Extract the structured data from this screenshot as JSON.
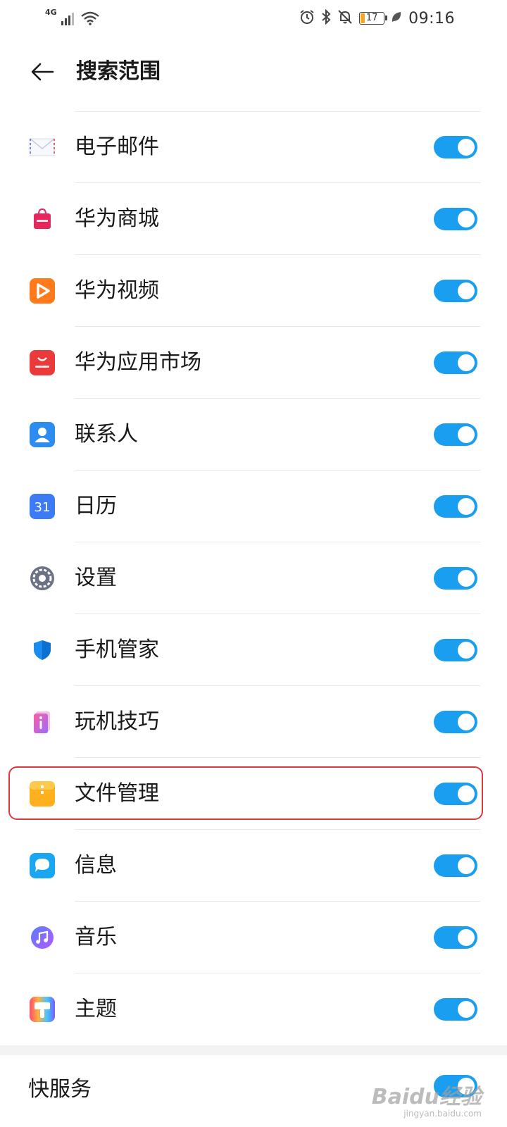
{
  "status_bar": {
    "network": "4G",
    "time": "09:16",
    "battery": "17",
    "battery_level_percent": 17,
    "icons": [
      "signal-icon",
      "wifi-icon",
      "alarm-icon",
      "bluetooth-icon",
      "mute-icon",
      "battery-icon",
      "leaf-icon"
    ]
  },
  "header": {
    "title": "搜索范围",
    "back_icon": "back-arrow-icon"
  },
  "items": [
    {
      "label": "电子邮件",
      "icon": "email-icon",
      "enabled": true
    },
    {
      "label": "华为商城",
      "icon": "vmall-icon",
      "enabled": true
    },
    {
      "label": "华为视频",
      "icon": "video-icon",
      "enabled": true
    },
    {
      "label": "华为应用市场",
      "icon": "appgallery-icon",
      "enabled": true
    },
    {
      "label": "联系人",
      "icon": "contacts-icon",
      "enabled": true
    },
    {
      "label": "日历",
      "icon": "calendar-icon",
      "enabled": true,
      "icon_text": "31"
    },
    {
      "label": "设置",
      "icon": "settings-icon",
      "enabled": true
    },
    {
      "label": "手机管家",
      "icon": "phone-manager-icon",
      "enabled": true
    },
    {
      "label": "玩机技巧",
      "icon": "tips-icon",
      "enabled": true
    },
    {
      "label": "文件管理",
      "icon": "files-icon",
      "enabled": true,
      "highlighted": true
    },
    {
      "label": "信息",
      "icon": "messages-icon",
      "enabled": true
    },
    {
      "label": "音乐",
      "icon": "music-icon",
      "enabled": true
    },
    {
      "label": "主题",
      "icon": "themes-icon",
      "enabled": true
    }
  ],
  "quick_service": {
    "label": "快服务",
    "enabled": true
  },
  "watermark": {
    "main": "Baidu经验",
    "sub": "jingyan.baidu.com"
  },
  "colors": {
    "toggle_on": "#1a9ef0",
    "highlight": "#d93a3f",
    "divider": "#e8e8e8"
  }
}
